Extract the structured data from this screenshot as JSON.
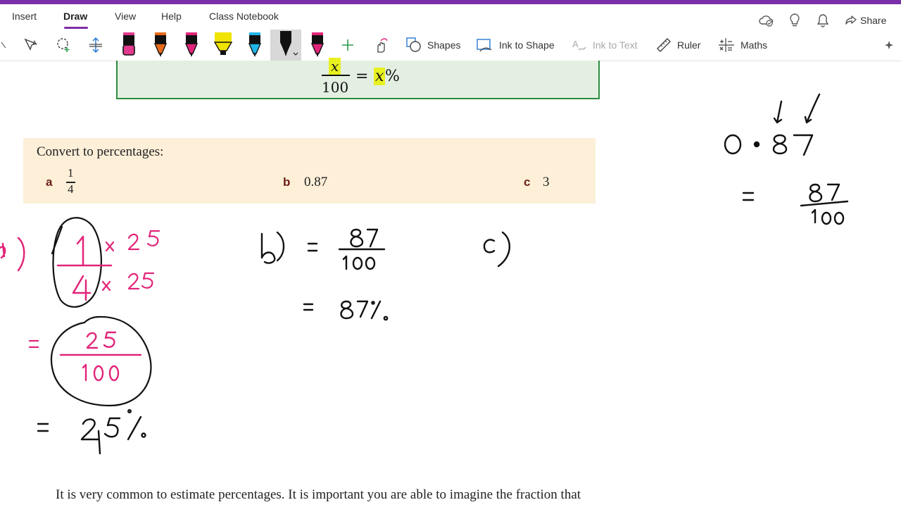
{
  "ribbon": {
    "tabs": [
      "Insert",
      "Draw",
      "View",
      "Help",
      "Class Notebook"
    ],
    "active_tab": "Draw",
    "share_label": "Share"
  },
  "toolbar": {
    "shapes_label": "Shapes",
    "ink_to_shape_label": "Ink to Shape",
    "ink_to_text_label": "Ink to Text",
    "ruler_label": "Ruler",
    "maths_label": "Maths",
    "pen_colors": [
      "#e23a8d",
      "#e86a1a",
      "#e2247a",
      "#f0e400",
      "#20b5e8",
      "#111111",
      "#e2247a"
    ]
  },
  "page": {
    "formula": {
      "numerator": "x",
      "denominator": "100",
      "equals": "=",
      "rhs_var": "x",
      "rhs_pct": "%"
    },
    "exercise": {
      "title": "Convert to percentages:",
      "items": [
        {
          "letter": "a",
          "numerator": "1",
          "denominator": "4"
        },
        {
          "letter": "b",
          "value": "0.87"
        },
        {
          "letter": "c",
          "value": "3"
        }
      ]
    },
    "bottom_text": "It is very common to estimate percentages. It is important you are able to imagine the fraction that"
  },
  "colors": {
    "accent": "#7b2fa8",
    "ink_pink": "#e2247a",
    "ink_black": "#111111",
    "exercise_bg": "#fdefd8",
    "formula_bg": "#e3f0e1"
  }
}
